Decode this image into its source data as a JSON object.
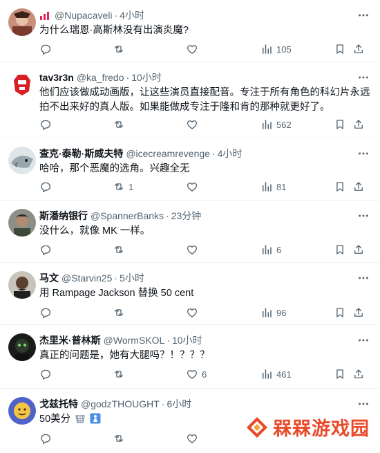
{
  "tweets": [
    {
      "name": "",
      "handle": "@Nupacaveli",
      "time": "4小时",
      "text": "为什么瑞恩·高斯林没有出演炎魔?",
      "replies": "",
      "retweets": "",
      "likes": "",
      "views": "105"
    },
    {
      "name": "tav3r3n",
      "handle": "@ka_fredo",
      "time": "10小时",
      "text": "他们应该做成动画版，让这些演员直接配音。专注于所有角色的科幻片永远拍不出来好的真人版。如果能做成专注于隆和肯的那种就更好了。",
      "replies": "",
      "retweets": "",
      "likes": "",
      "views": "562"
    },
    {
      "name": "查克·泰勒·斯威夫特",
      "handle": "@icecreamrevenge",
      "time": "4小时",
      "text": "哈哈，那个恶魔的选角。兴趣全无",
      "replies": "",
      "retweets": "1",
      "likes": "",
      "views": "81"
    },
    {
      "name": "斯潘纳银行",
      "handle": "@SpannerBanks",
      "time": "23分钟",
      "text": "没什么，就像 MK 一样。",
      "replies": "",
      "retweets": "",
      "likes": "",
      "views": "6"
    },
    {
      "name": "马文",
      "handle": "@Starvin25",
      "time": "5小时",
      "text": "用 Rampage Jackson 替换 50 cent",
      "replies": "",
      "retweets": "",
      "likes": "",
      "views": "96"
    },
    {
      "name": "杰里米·普林斯",
      "handle": "@WormSKOL",
      "time": "10小时",
      "text": "真正的问题是，她有大腿吗？！？？？",
      "replies": "",
      "retweets": "",
      "likes": "6",
      "views": "461"
    },
    {
      "name": "戈兹托特",
      "handle": "@godzTHOUGHT",
      "time": "6小时",
      "text": "50美分",
      "replies": "",
      "retweets": "",
      "likes": "",
      "views": ""
    }
  ],
  "dot": "·",
  "watermark": {
    "text": "槑槑游戏园",
    "color": "#e94a2c"
  },
  "colors": {
    "secondary": "#536471",
    "primary": "#0f1419",
    "divider": "#eff3f4"
  }
}
